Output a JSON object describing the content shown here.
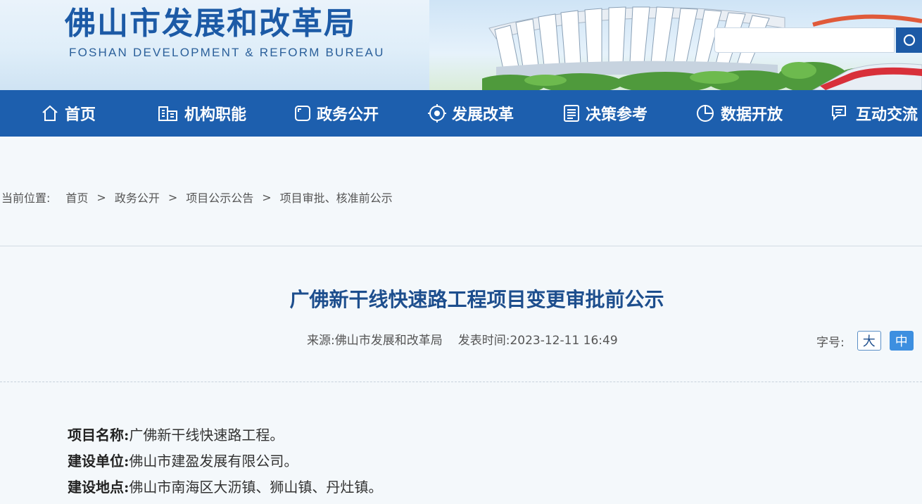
{
  "header": {
    "title": "佛山市发展和改革局",
    "subtitle": "FOSHAN DEVELOPMENT & REFORM BUREAU",
    "search": {
      "placeholder": "",
      "icon": "search-icon"
    },
    "brand_color": "#1c5aa6"
  },
  "nav": {
    "items": [
      {
        "label": "首页",
        "icon": "home-icon"
      },
      {
        "label": "机构职能",
        "icon": "building-icon"
      },
      {
        "label": "政务公开",
        "icon": "square-icon"
      },
      {
        "label": "发展改革",
        "icon": "target-icon"
      },
      {
        "label": "决策参考",
        "icon": "document-icon"
      },
      {
        "label": "数据开放",
        "icon": "pie-chart-icon"
      },
      {
        "label": "互动交流",
        "icon": "chat-icon"
      }
    ]
  },
  "breadcrumb": {
    "label": "当前位置:",
    "items": [
      "首页",
      "政务公开",
      "项目公示公告",
      "项目审批、核准前公示"
    ],
    "separator": ">"
  },
  "article": {
    "title": "广佛新干线快速路工程项目变更审批前公示",
    "source_label": "来源:",
    "source": "佛山市发展和改革局",
    "time_label": "发表时间:",
    "time": "2023-12-11 16:49",
    "font_size": {
      "label": "字号:",
      "large": "大",
      "medium": "中"
    },
    "fields": [
      {
        "key": "项目名称:",
        "value": "广佛新干线快速路工程。"
      },
      {
        "key": "建设单位:",
        "value": "佛山市建盈发展有限公司。"
      },
      {
        "key": "建设地点:",
        "value": "佛山市南海区大沥镇、狮山镇、丹灶镇。"
      }
    ]
  }
}
